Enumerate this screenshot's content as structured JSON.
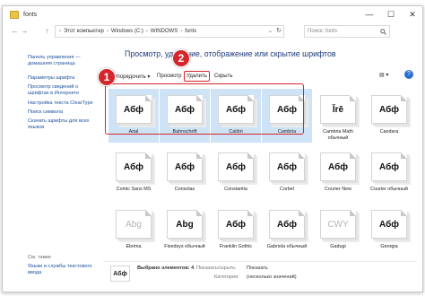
{
  "window": {
    "title": "fonts",
    "minimize": "—",
    "maximize": "☐",
    "close": "✕"
  },
  "address": {
    "back": "←",
    "forward": "→",
    "up": "↑",
    "crumbs": [
      "Этот компьютер",
      "Windows (C:)",
      "WINDOWS",
      "fonts"
    ],
    "separator": "›",
    "refresh": "↻",
    "search_placeholder": "Поиск: fonts",
    "search_icon": "search-icon"
  },
  "sidebar": {
    "links": [
      "Панель управления — домашняя страница",
      "Параметры шрифта",
      "Просмотр сведений о шрифтах в Интернете",
      "Настройка текста ClearType",
      "Поиск символа",
      "Скачать шрифты для всех языков"
    ],
    "see_also_title": "См. также",
    "see_also": [
      "Языки и службы текстового ввода"
    ]
  },
  "heading": "Просмотр, удаление, отображение или скрытие шрифтов",
  "toolbar": {
    "organize": "Упорядочить ▾",
    "preview": "Просмотр",
    "delete": "Удалить",
    "hide": "Скрыть"
  },
  "badges": [
    "1",
    "2"
  ],
  "fonts": [
    {
      "sample": "Абф",
      "name": "Arial",
      "selected": true,
      "dim": false
    },
    {
      "sample": "Абф",
      "name": "Bahnschrift",
      "selected": true,
      "dim": false
    },
    {
      "sample": "Абф",
      "name": "Calibri",
      "selected": true,
      "dim": false
    },
    {
      "sample": "Абф",
      "name": "Cambria",
      "selected": true,
      "dim": false
    },
    {
      "sample": "Ĭrē",
      "name": "Cambria Math обычный",
      "selected": false,
      "dim": false
    },
    {
      "sample": "Абф",
      "name": "Candara",
      "selected": false,
      "dim": false
    },
    {
      "sample": "Абф",
      "name": "Comic Sans MS",
      "selected": false,
      "dim": false
    },
    {
      "sample": "Абф",
      "name": "Consolas",
      "selected": false,
      "dim": false
    },
    {
      "sample": "Абф",
      "name": "Constantia",
      "selected": false,
      "dim": false
    },
    {
      "sample": "Абф",
      "name": "Corbel",
      "selected": false,
      "dim": false
    },
    {
      "sample": "Абф",
      "name": "Courier New",
      "selected": false,
      "dim": false
    },
    {
      "sample": "Абф",
      "name": "Courier обычный",
      "selected": false,
      "dim": false
    },
    {
      "sample": "Abg",
      "name": "Ebrima",
      "selected": false,
      "dim": true
    },
    {
      "sample": "Abg",
      "name": "Fixedsys обычный",
      "selected": false,
      "dim": false
    },
    {
      "sample": "Абф",
      "name": "Franklin Gothic",
      "selected": false,
      "dim": false
    },
    {
      "sample": "Абф",
      "name": "Gabriola обычный",
      "selected": false,
      "dim": false
    },
    {
      "sample": "CWY",
      "name": "Gadugi",
      "selected": false,
      "dim": true
    },
    {
      "sample": "Абф",
      "name": "Georgia",
      "selected": false,
      "dim": false
    }
  ],
  "status": {
    "icon_sample": "Абф",
    "selected_text": "Выбрано элементов: 4",
    "show_label": "Показать/скрыть:",
    "show_value": "Показать",
    "category_label": "Категория:",
    "category_value": "(несколько значений)"
  },
  "colors": {
    "highlight": "#d4262c",
    "selection": "#cfe3f7",
    "link": "#1a4f9c",
    "heading": "#1f3b7a"
  }
}
